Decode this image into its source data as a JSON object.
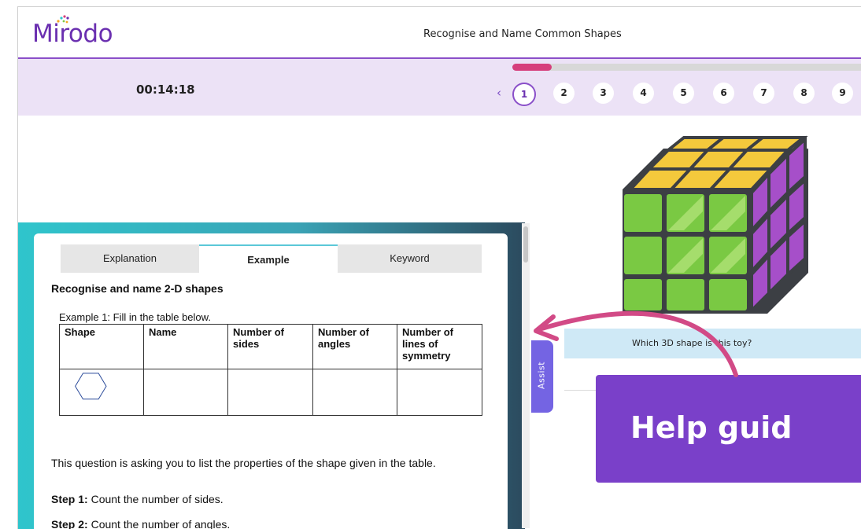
{
  "app": {
    "logo_text": "Mirodo"
  },
  "header": {
    "title": "Recognise and Name Common Shapes"
  },
  "subbar": {
    "timer": "00:14:18",
    "progress_fraction": 0.11,
    "pages": [
      "1",
      "2",
      "3",
      "4",
      "5",
      "6",
      "7",
      "8",
      "9"
    ],
    "active_page": "1",
    "prev_icon": "chevron-left-icon"
  },
  "panel": {
    "tabs": [
      {
        "label": "Explanation",
        "active": false
      },
      {
        "label": "Example",
        "active": true
      },
      {
        "label": "Keyword",
        "active": false
      }
    ],
    "heading": "Recognise and name 2-D shapes",
    "example_intro": "Example 1: Fill in the table below.",
    "table": {
      "headers": [
        "Shape",
        "Name",
        "Number of sides",
        "Number of angles",
        "Number of lines of symmetry"
      ],
      "row_shape_icon": "hexagon-icon"
    },
    "paragraph": "This question is asking you to list the properties of the shape given in the table.",
    "step1_label": "Step 1:",
    "step1_text": " Count the number of sides.",
    "step2_label": "Step 2:",
    "step2_text": " Count the number of angles."
  },
  "assist": {
    "label": "Assist"
  },
  "question": {
    "text": "Which 3D shape is this toy?",
    "image_icon": "rubiks-cube-icon"
  },
  "callout": {
    "text": "Help guid"
  },
  "colors": {
    "brand_purple": "#6a2fb0",
    "accent_pink": "#d63f7c",
    "subbar_bg": "#ece2f6",
    "callout_bg": "#7a40c9",
    "assist_bg": "#7464e3",
    "question_bg": "#cfe9f6"
  }
}
